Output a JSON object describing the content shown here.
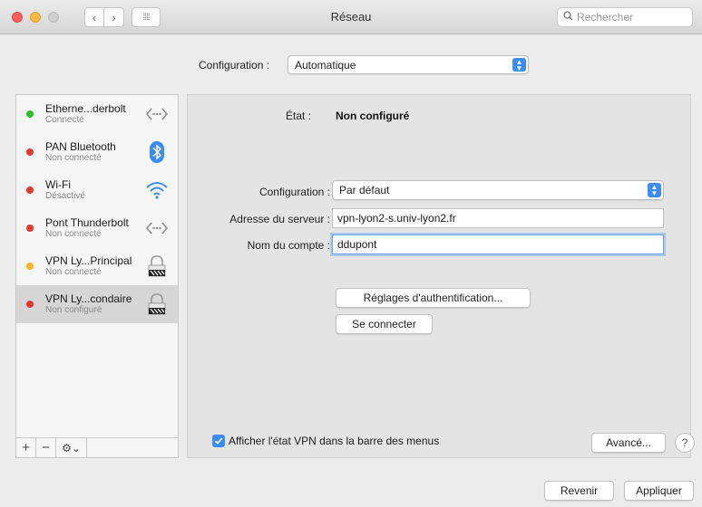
{
  "window": {
    "title": "Réseau",
    "search_placeholder": "Rechercher",
    "nav_back": "‹",
    "nav_forward": "›",
    "grid_icon": "⁞⁞⁞⁞"
  },
  "top_config": {
    "label": "Configuration :",
    "value": "Automatique"
  },
  "services": [
    {
      "name": "Etherne...derbolt",
      "status": "Connecté",
      "dot": "#2bc02b",
      "icon": "ethernet-icon"
    },
    {
      "name": "PAN Bluetooth",
      "status": "Non connecté",
      "dot": "#e2382f",
      "icon": "bluetooth-icon"
    },
    {
      "name": "Wi-Fi",
      "status": "Désactivé",
      "dot": "#e2382f",
      "icon": "wifi-icon"
    },
    {
      "name": "Pont Thunderbolt",
      "status": "Non connecté",
      "dot": "#e2382f",
      "icon": "thunderbolt-bridge-icon"
    },
    {
      "name": "VPN Ly...Principal",
      "status": "Non connecté",
      "dot": "#f5b824",
      "icon": "vpn-lock-icon"
    },
    {
      "name": "VPN Ly...condaire",
      "status": "Non configuré",
      "dot": "#e2382f",
      "icon": "vpn-lock-icon"
    }
  ],
  "sidebar_tools": {
    "add": "+",
    "remove": "−",
    "action": "⚙⌄"
  },
  "detail": {
    "state_label": "État :",
    "state_value": "Non configuré",
    "config_label": "Configuration :",
    "config_value": "Par défaut",
    "server_label": "Adresse du serveur :",
    "server_value": "vpn-lyon2-s.univ-lyon2.fr",
    "account_label": "Nom du compte :",
    "account_value": "ddupont",
    "auth_button": "Réglages d'authentification...",
    "connect_button": "Se connecter",
    "show_vpn_label": "Afficher l'état VPN dans la barre des menus",
    "show_vpn_checked": true,
    "advanced_button": "Avancé...",
    "help": "?"
  },
  "footer": {
    "revert": "Revenir",
    "apply": "Appliquer"
  },
  "colors": {
    "accent": "#3b8cf5",
    "connected": "#2bc02b",
    "disconnected": "#e2382f",
    "pending": "#f5b824"
  }
}
